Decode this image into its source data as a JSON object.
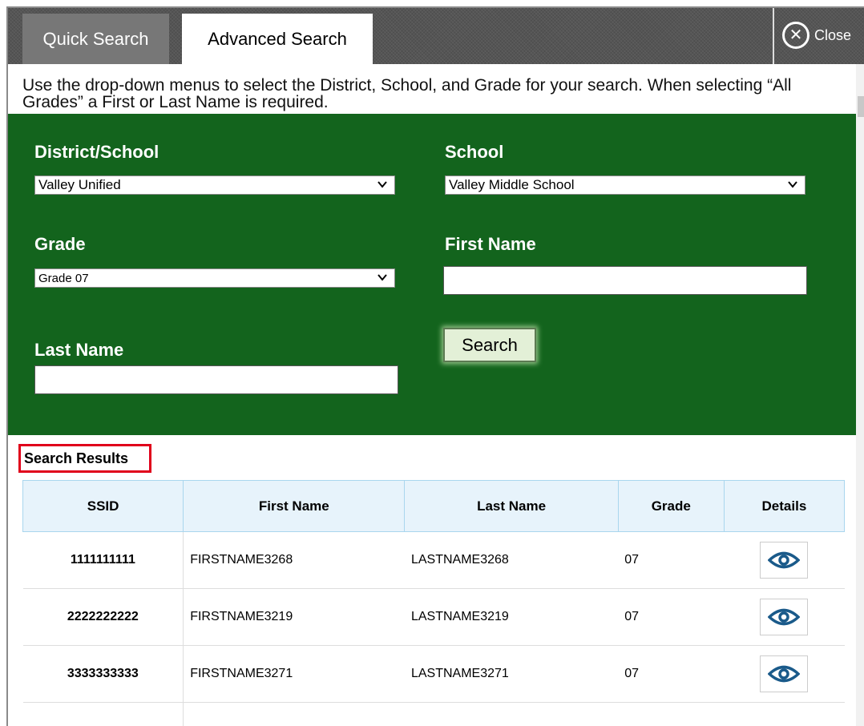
{
  "tabs": {
    "quick_search": "Quick Search",
    "advanced_search": "Advanced Search",
    "close_label": "Close"
  },
  "instructions": "Use the drop-down menus to select the District, School, and Grade for your search. When selecting “All Grades” a First or Last Name is required.",
  "form": {
    "district_label": "District/School",
    "district_value": "Valley Unified",
    "school_label": "School",
    "school_value": "Valley Middle School",
    "grade_label": "Grade",
    "grade_value": "Grade 07",
    "first_name_label": "First Name",
    "first_name_value": "",
    "last_name_label": "Last Name",
    "last_name_value": "",
    "search_button": "Search"
  },
  "results": {
    "title": "Search Results",
    "columns": [
      "SSID",
      "First Name",
      "Last Name",
      "Grade",
      "Details"
    ],
    "rows": [
      {
        "ssid": "1111111111",
        "first_name": "FIRSTNAME3268",
        "last_name": "LASTNAME3268",
        "grade": "07"
      },
      {
        "ssid": "2222222222",
        "first_name": "FIRSTNAME3219",
        "last_name": "LASTNAME3219",
        "grade": "07"
      },
      {
        "ssid": "3333333333",
        "first_name": "FIRSTNAME3271",
        "last_name": "LASTNAME3271",
        "grade": "07"
      }
    ]
  },
  "colors": {
    "panel_green": "#13641d",
    "tabbar_gray": "#555555",
    "highlight_red": "#e0001b",
    "header_blue": "#e7f3fb",
    "eye_icon_blue": "#1a5a8a"
  }
}
